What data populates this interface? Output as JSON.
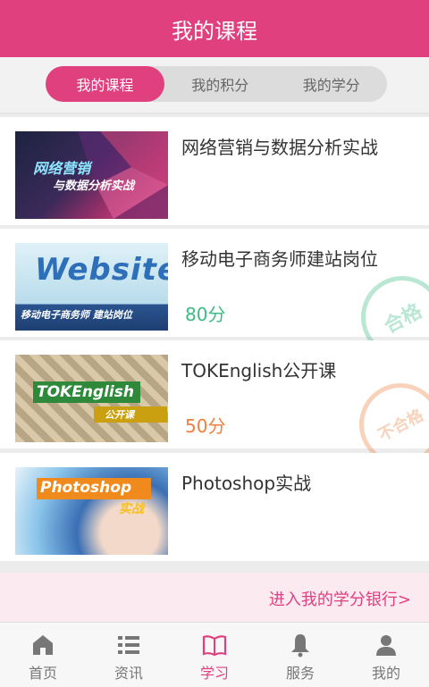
{
  "header": {
    "title": "我的课程"
  },
  "tabs": [
    {
      "label": "我的课程",
      "active": true
    },
    {
      "label": "我的积分",
      "active": false
    },
    {
      "label": "我的学分",
      "active": false
    }
  ],
  "courses": [
    {
      "title": "网络营销与数据分析实战",
      "thumb_text_1": "网络营销",
      "thumb_text_2": "与数据分析实战",
      "score": "",
      "stamp": ""
    },
    {
      "title": "移动电子商务师建站岗位",
      "thumb_text_1": "Website",
      "thumb_text_2": "移动电子商务师 建站岗位",
      "score": "80分",
      "stamp": "合格"
    },
    {
      "title": "TOKEnglish公开课",
      "thumb_text_1": "TOKEnglish",
      "thumb_text_2": "公开课",
      "score": "50分",
      "stamp": "不合格"
    },
    {
      "title": "Photoshop实战",
      "thumb_text_1": "Photoshop",
      "thumb_text_2": "实战",
      "score": "",
      "stamp": ""
    }
  ],
  "bank_link": "进入我的学分银行>",
  "nav": [
    {
      "label": "首页",
      "icon": "home-icon"
    },
    {
      "label": "资讯",
      "icon": "list-icon"
    },
    {
      "label": "学习",
      "icon": "book-icon",
      "active": true
    },
    {
      "label": "服务",
      "icon": "bell-icon"
    },
    {
      "label": "我的",
      "icon": "user-icon"
    }
  ],
  "colors": {
    "accent": "#e1407f",
    "pass": "#3dbb85",
    "fail": "#f08040"
  }
}
